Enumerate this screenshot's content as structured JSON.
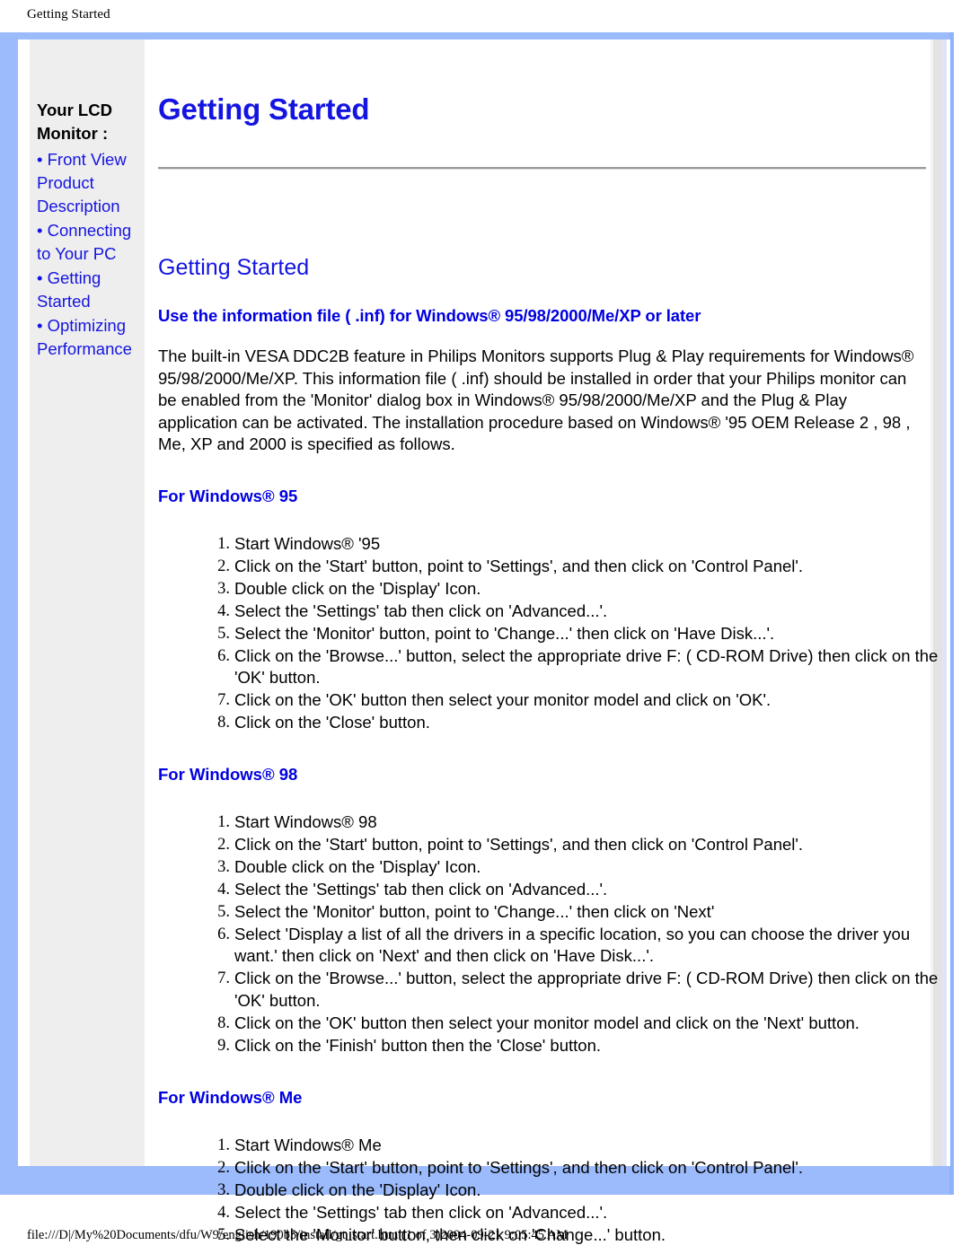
{
  "print": {
    "header": "Getting Started",
    "footer": "file:///D|/My%20Documents/dfu/W9/english/190b5/install/gt_start.htm (1 of 3)2004-09-21 9:05:45 AM"
  },
  "colors": {
    "frame_blue": "#9cbbfc",
    "link_blue": "#1414e0",
    "heading_blue": "#0000e0",
    "sidebar_bg": "#eeeeee",
    "rule_gray": "#9a9a9a"
  },
  "sidebar": {
    "title": "Your LCD Monitor :",
    "items": [
      {
        "label": "Front View Product Description"
      },
      {
        "label": "Connecting to Your PC"
      },
      {
        "label": "Getting Started"
      },
      {
        "label": "Optimizing Performance"
      }
    ]
  },
  "content": {
    "doc_title": "Getting Started",
    "section_title": "Getting Started",
    "major_heading": "Use the information file ( .inf) for Windows® 95/98/2000/Me/XP or later",
    "intro_paragraph": "The built-in VESA DDC2B feature in Philips Monitors supports Plug & Play requirements for Windows® 95/98/2000/Me/XP. This information file ( .inf) should be installed in order that your Philips monitor can be enabled from the 'Monitor' dialog box in Windows® 95/98/2000/Me/XP and the Plug & Play application can be activated. The installation procedure based on Windows® '95 OEM Release 2 , 98 , Me, XP and 2000 is specified as follows.",
    "sections": [
      {
        "heading": "For Windows® 95",
        "steps": [
          "Start Windows® '95",
          "Click on the 'Start' button, point to 'Settings', and then click on 'Control Panel'.",
          "Double click on the 'Display' Icon.",
          "Select the 'Settings' tab then click on 'Advanced...'.",
          "Select the 'Monitor' button, point to 'Change...' then click on 'Have Disk...'.",
          "Click on the 'Browse...' button, select the appropriate drive F: ( CD-ROM Drive) then click on the 'OK' button.",
          "Click on the 'OK' button then select your monitor model and click on 'OK'.",
          "Click on the 'Close' button."
        ]
      },
      {
        "heading": "For Windows® 98",
        "steps": [
          "Start Windows® 98",
          "Click on the 'Start' button, point to 'Settings', and then click on 'Control Panel'.",
          "Double click on the 'Display' Icon.",
          "Select the 'Settings' tab then click on 'Advanced...'.",
          "Select the 'Monitor' button, point to 'Change...' then click on 'Next'",
          "Select 'Display a list of all the drivers in a specific location, so you can choose the driver you want.' then click on 'Next' and then click on 'Have Disk...'.",
          "Click on the 'Browse...' button, select the appropriate drive F: ( CD-ROM Drive) then click on the 'OK' button.",
          "Click on the 'OK' button then select your monitor model and click on the 'Next' button.",
          "Click on the 'Finish' button then the 'Close' button."
        ]
      },
      {
        "heading": "For Windows® Me",
        "steps": [
          "Start Windows® Me",
          "Click on the 'Start' button, point to 'Settings', and then click on 'Control Panel'.",
          "Double click on the 'Display' Icon.",
          "Select the 'Settings' tab then click on 'Advanced...'.",
          "Select the 'Monitor' button, then click on 'Change...' button."
        ]
      }
    ]
  }
}
